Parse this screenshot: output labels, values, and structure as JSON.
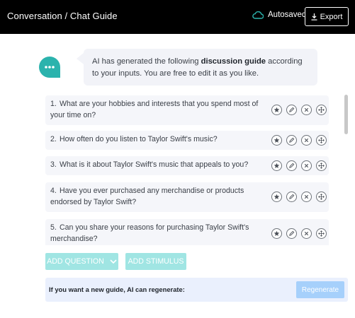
{
  "header": {
    "title": "Conversation / Chat Guide",
    "autosave_label": "Autosaved",
    "export_label": "Export"
  },
  "intro": {
    "part1": "AI has generated the following ",
    "bold": "discussion guide",
    "part2": " according to your inputs. You are free to edit it as you like."
  },
  "questions": [
    {
      "num": "1.",
      "text": "What are your hobbies and interests that you spend most of your time on?"
    },
    {
      "num": "2.",
      "text": "How often do you listen to Taylor Swift's music?"
    },
    {
      "num": "3.",
      "text": "What is it about Taylor Swift's music that appeals to you?"
    },
    {
      "num": "4.",
      "text": "Have you ever purchased any merchandise or products endorsed by Taylor Swift?"
    },
    {
      "num": "5.",
      "text": "Can you share your reasons for purchasing Taylor Swift's merchandise?"
    }
  ],
  "question_actions": [
    "star-icon",
    "edit-icon",
    "close-icon",
    "move-icon"
  ],
  "buttons": {
    "add_question": "ADD QUESTION",
    "add_stimulus": "ADD STIMULUS"
  },
  "regenerate": {
    "prompt": "If you want a new guide, AI can regenerate:",
    "button": "Regenerate"
  },
  "colors": {
    "accent": "#2bb3ad",
    "accent_disabled": "#a0e5e3",
    "regen_panel": "#eaf0fd",
    "regen_button": "#a6d0fb"
  }
}
